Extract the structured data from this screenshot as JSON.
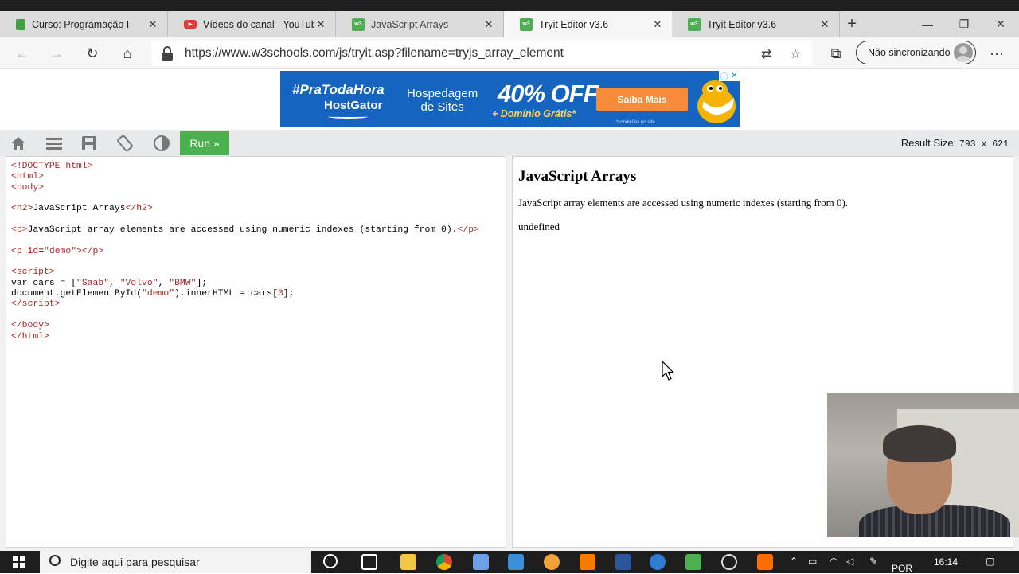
{
  "browser": {
    "tabs": [
      {
        "title": "Curso: Programação I",
        "favicon_color": "#44a047",
        "active": false
      },
      {
        "title": "Vídeos do canal - YouTube",
        "favicon_color": "#e53935",
        "active": false
      },
      {
        "title": "JavaScript Arrays",
        "favicon_color": "#4caf50",
        "active": false
      },
      {
        "title": "Tryit Editor v3.6",
        "favicon_color": "#4caf50",
        "active": true
      },
      {
        "title": "Tryit Editor v3.6",
        "favicon_color": "#4caf50",
        "active": false
      }
    ],
    "url": "https://www.w3schools.com/js/tryit.asp?filename=tryjs_array_element",
    "sync_label": "Não sincronizando"
  },
  "ad": {
    "hashtag": "#PraTodaHora",
    "brand": "HostGator",
    "product_line1": "Hospedagem",
    "product_line2": "de Sites",
    "discount": "40% OFF",
    "bonus": "+ Domínio Grátis*",
    "cta": "Saiba Mais",
    "fine_print": "*condições no site"
  },
  "toolbar": {
    "run_label": "Run »",
    "result_size_label": "Result Size:",
    "result_size_value": "793 x 621"
  },
  "result": {
    "heading": "JavaScript Arrays",
    "paragraph": "JavaScript array elements are accessed using numeric indexes (starting from 0).",
    "demo_output": "undefined"
  },
  "taskbar": {
    "search_placeholder": "Digite aqui para pesquisar",
    "lang": "POR",
    "time": "16:14"
  },
  "colors": {
    "run_button": "#4caf50",
    "toolbar_bg": "#e7e9eb",
    "ad_bg": "#1565c0",
    "ad_cta": "#f68b3a"
  }
}
